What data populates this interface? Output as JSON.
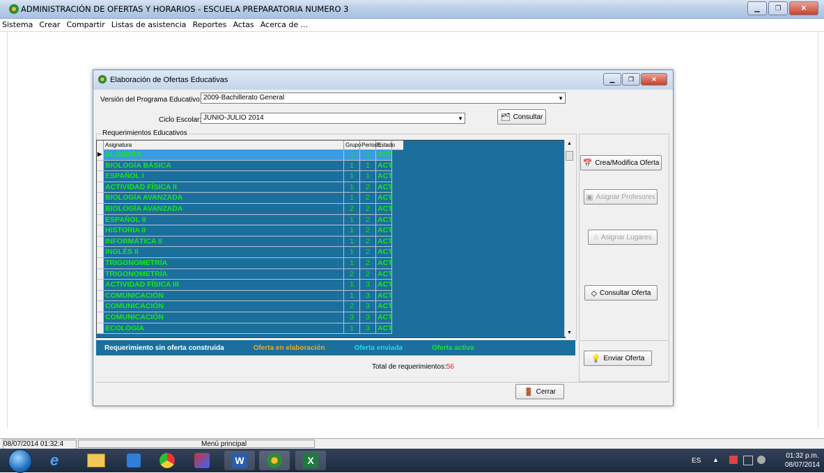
{
  "window": {
    "title": "ADMINISTRACIÓN DE OFERTAS Y HORARIOS - ESCUELA PREPARATORIA NUMERO 3"
  },
  "menu": [
    "Sistema",
    "Crear",
    "Compartir",
    "Listas de asistencia",
    "Reportes",
    "Actas",
    "Acerca de ..."
  ],
  "dialog": {
    "title": "Elaboración de Ofertas Educativas",
    "version_label": "Versión del Programa Educativo:",
    "version_value": "2009-Bachillerato General",
    "ciclo_label": "Ciclo Escolar:",
    "ciclo_value": "JUNIO-JULIO 2014",
    "consultar_label": "Consultar",
    "group_title": "Requerimientos Educativos",
    "columns": [
      "Asignatura",
      "Grupo",
      "Periodo",
      "Estado"
    ],
    "rows": [
      {
        "asignatura": "ALGEBRA",
        "grupo": "1",
        "periodo": "1",
        "estado": "ACT"
      },
      {
        "asignatura": "BIOLOGÍA BÁSICA",
        "grupo": "1",
        "periodo": "1",
        "estado": "ACT"
      },
      {
        "asignatura": "ESPAÑOL I",
        "grupo": "1",
        "periodo": "1",
        "estado": "ACT"
      },
      {
        "asignatura": "ACTIVIDAD FÍSICA II",
        "grupo": "1",
        "periodo": "2",
        "estado": "ACT"
      },
      {
        "asignatura": "BIOLOGÍA AVANZADA",
        "grupo": "1",
        "periodo": "2",
        "estado": "ACT"
      },
      {
        "asignatura": "BIOLOGÍA AVANZADA",
        "grupo": "2",
        "periodo": "2",
        "estado": "ACT"
      },
      {
        "asignatura": "ESPAÑOL II",
        "grupo": "1",
        "periodo": "2",
        "estado": "ACT"
      },
      {
        "asignatura": "HISTORIA II",
        "grupo": "1",
        "periodo": "2",
        "estado": "ACT"
      },
      {
        "asignatura": "INFORMÁTICA II",
        "grupo": "1",
        "periodo": "2",
        "estado": "ACT"
      },
      {
        "asignatura": "INGLÉS II",
        "grupo": "1",
        "periodo": "2",
        "estado": "ACT"
      },
      {
        "asignatura": "TRIGONOMETRÍA",
        "grupo": "1",
        "periodo": "2",
        "estado": "ACT"
      },
      {
        "asignatura": "TRIGONOMETRÍA",
        "grupo": "2",
        "periodo": "2",
        "estado": "ACT"
      },
      {
        "asignatura": "ACTIVIDAD FÍSICA III",
        "grupo": "1",
        "periodo": "3",
        "estado": "ACT"
      },
      {
        "asignatura": "COMUNICACIÓN",
        "grupo": "1",
        "periodo": "3",
        "estado": "ACT"
      },
      {
        "asignatura": "COMUNICACIÓN",
        "grupo": "2",
        "periodo": "3",
        "estado": "ACT"
      },
      {
        "asignatura": "COMUNICACIÓN",
        "grupo": "3",
        "periodo": "3",
        "estado": "ACT"
      },
      {
        "asignatura": "ECOLOGÍA",
        "grupo": "1",
        "periodo": "3",
        "estado": "ACT"
      }
    ],
    "buttons": {
      "crear": "Crea/Modifica Oferta",
      "asignar_profesores": "Asignar Profesores",
      "asignar_lugares": "Asignar Lugares",
      "consultar_oferta": "Consultar Oferta",
      "enviar_oferta": "Enviar Oferta",
      "cerrar": "Cerrar"
    },
    "legend": [
      {
        "label": "Requerimiento sin oferta construida",
        "color": "#ffffff"
      },
      {
        "label": "Oferta en elaboración",
        "color": "#f2a81e"
      },
      {
        "label": "Oferta enviada",
        "color": "#22d8f0"
      },
      {
        "label": "Oferta activa",
        "color": "#1ee61e"
      }
    ],
    "total_label": "Total de requerimientos:",
    "total_value": "56"
  },
  "status": {
    "left": "08/07/2014 01:32:4",
    "right": "Menú principal"
  },
  "taskbar": {
    "lang": "ES",
    "time": "01:32 p.m.",
    "date": "08/07/2014"
  },
  "colors": {
    "grid_bg": "#1a6f9d",
    "grid_text": "#19e619",
    "selected_row": "#3a9ce0"
  }
}
